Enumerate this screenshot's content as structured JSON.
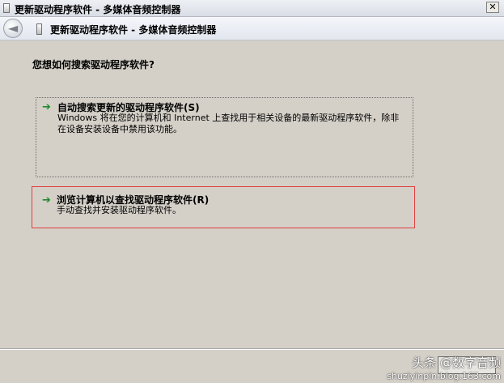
{
  "window": {
    "title": "更新驱动程序软件 - 多媒体音频控制器",
    "close_label": "✕"
  },
  "nav": {
    "back_glyph": "◄",
    "title": "更新驱动程序软件 - 多媒体音频控制器"
  },
  "page": {
    "question": "您想如何搜索驱动程序软件?",
    "options": [
      {
        "title": "自动搜索更新的驱动程序软件(S)",
        "description": "Windows 将在您的计算机和 Internet 上查找用于相关设备的最新驱动程序软件，除非在设备安装设备中禁用该功能。",
        "icon": "green-arrow-icon"
      },
      {
        "title": "浏览计算机以查找驱动程序软件(R)",
        "description": "手动查找并安装驱动程序软件。",
        "icon": "green-arrow-icon"
      }
    ]
  },
  "footer": {
    "cancel_label": ""
  },
  "watermark": {
    "line1": "头条 @数字音频",
    "line2": "shuziyinpin.blog.163.com"
  },
  "colors": {
    "background": "#d4d0c8",
    "selection_border": "#e04040",
    "arrow": "#1f8a2e"
  }
}
